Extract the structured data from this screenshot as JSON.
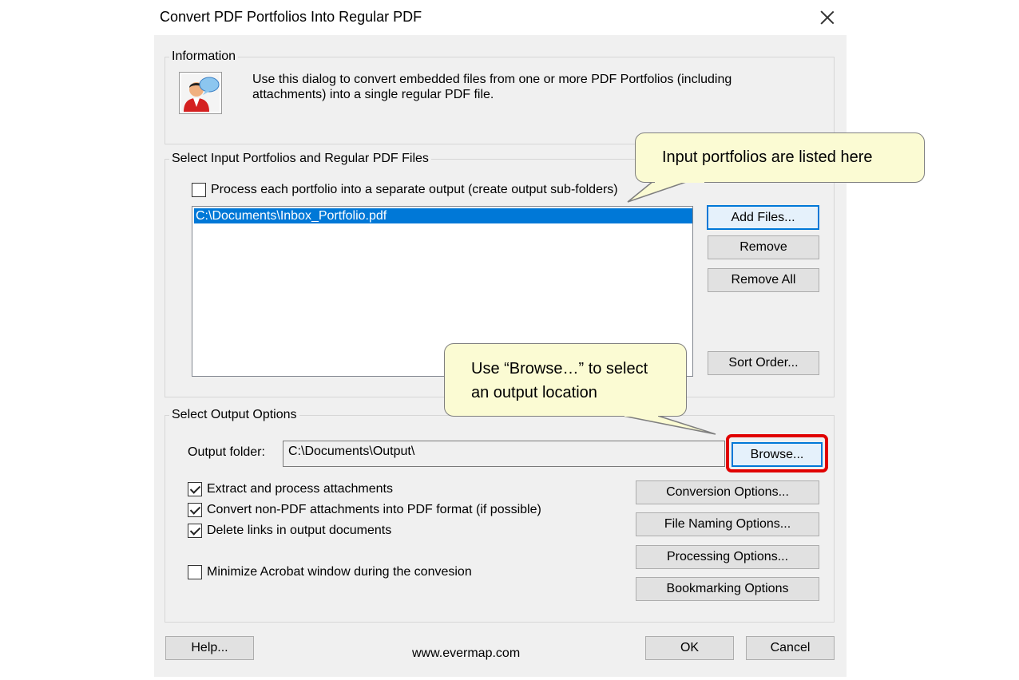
{
  "dialog": {
    "title": "Convert PDF Portfolios Into Regular PDF",
    "close_icon": "close-icon"
  },
  "information": {
    "legend": "Information",
    "icon": "user-chat-icon",
    "text_line1": "Use this dialog to convert embedded files from one or more PDF Portfolios (including",
    "text_line2": "attachments) into a single regular PDF file."
  },
  "input": {
    "legend": "Select Input Portfolios and Regular PDF Files",
    "separate_output_label": "Process each portfolio into a separate output (create output sub-folders)",
    "separate_output_checked": false,
    "files": [
      "C:\\Documents\\Inbox_Portfolio.pdf"
    ],
    "add_files_label": "Add Files...",
    "remove_label": "Remove",
    "remove_all_label": "Remove All",
    "sort_order_label": "Sort Order..."
  },
  "output": {
    "legend": "Select Output Options",
    "folder_label": "Output folder:",
    "folder_value": "C:\\Documents\\Output\\",
    "browse_label": "Browse...",
    "extract_label": "Extract and process attachments",
    "extract_checked": true,
    "convert_label": "Convert non-PDF attachments into PDF format (if possible)",
    "convert_checked": true,
    "delete_links_label": "Delete links in output documents",
    "delete_links_checked": true,
    "minimize_label": "Minimize Acrobat window during the convesion",
    "minimize_checked": false,
    "conversion_options_label": "Conversion Options...",
    "file_naming_label": "File Naming Options...",
    "processing_label": "Processing Options...",
    "bookmarking_label": "Bookmarking Options"
  },
  "footer": {
    "help_label": "Help...",
    "website": "www.evermap.com",
    "ok_label": "OK",
    "cancel_label": "Cancel"
  },
  "callouts": {
    "input_note": "Input portfolios are listed here",
    "browse_note_line1": "Use “Browse…” to select",
    "browse_note_line2": "an output location"
  },
  "colors": {
    "selection": "#0078d7",
    "callout_fill": "#fbfbd3",
    "highlight_border": "#e00000"
  }
}
